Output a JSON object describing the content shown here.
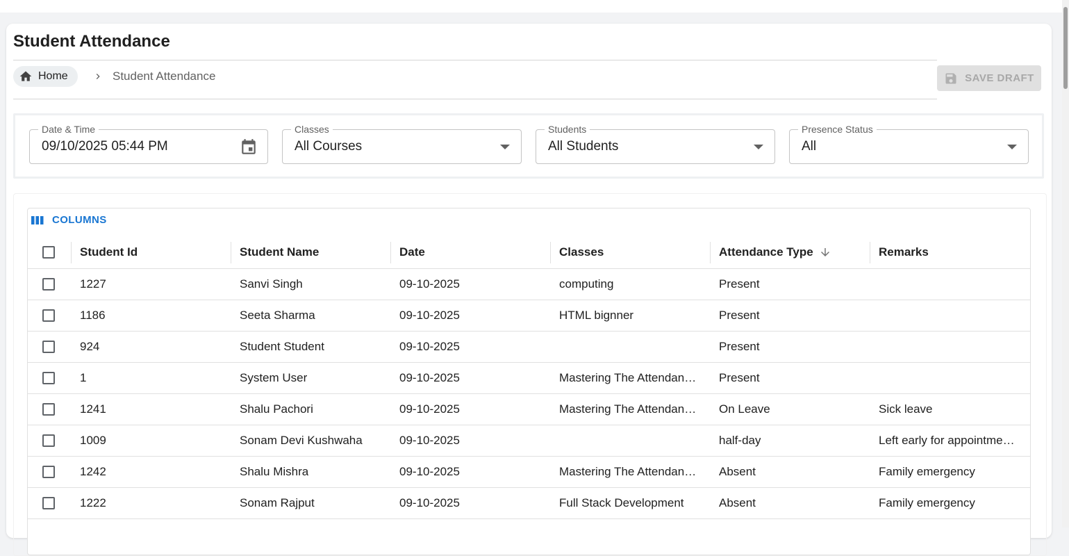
{
  "page": {
    "title": "Student Attendance"
  },
  "breadcrumb": {
    "home_label": "Home",
    "current": "Student Attendance"
  },
  "toolbar": {
    "save_draft_label": "SAVE DRAFT"
  },
  "filters": {
    "date_time": {
      "label": "Date & Time",
      "value": "09/10/2025 05:44 PM"
    },
    "classes": {
      "label": "Classes",
      "value": "All Courses"
    },
    "students": {
      "label": "Students",
      "value": "All Students"
    },
    "presence_status": {
      "label": "Presence Status",
      "value": "All"
    }
  },
  "grid": {
    "columns_button": "COLUMNS",
    "headers": [
      "Student Id",
      "Student Name",
      "Date",
      "Classes",
      "Attendance Type",
      "Remarks"
    ],
    "sorted_column": "Attendance Type",
    "sort_direction": "descending",
    "rows": [
      [
        "1227",
        "Sanvi Singh",
        "09-10-2025",
        "computing",
        "Present",
        ""
      ],
      [
        "1186",
        "Seeta Sharma",
        "09-10-2025",
        "HTML bignner",
        "Present",
        ""
      ],
      [
        "924",
        "Student Student",
        "09-10-2025",
        "",
        "Present",
        ""
      ],
      [
        "1",
        "System User",
        "09-10-2025",
        "Mastering The Attendan…",
        "Present",
        ""
      ],
      [
        "1241",
        "Shalu Pachori",
        "09-10-2025",
        "Mastering The Attendan…",
        "On Leave",
        "Sick leave"
      ],
      [
        "1009",
        "Sonam Devi Kushwaha",
        "09-10-2025",
        "",
        "half-day",
        "Left early for appointme…"
      ],
      [
        "1242",
        "Shalu Mishra",
        "09-10-2025",
        "Mastering The Attendan…",
        "Absent",
        "Family emergency"
      ],
      [
        "1222",
        "Sonam Rajput",
        "09-10-2025",
        "Full Stack Development",
        "Absent",
        "Family emergency"
      ]
    ]
  },
  "colors": {
    "accent": "#1976d2",
    "background": "#f2f3f5",
    "disabled_button_bg": "#e0e0e0",
    "disabled_button_text": "#a8a8a8"
  },
  "icons": {
    "home": "home-icon",
    "breadcrumb_separator": "chevron-right-icon",
    "save": "floppy-disk-icon",
    "calendar": "calendar-icon",
    "dropdown": "caret-down-icon",
    "columns": "columns-icon",
    "sort": "arrow-down-icon"
  }
}
